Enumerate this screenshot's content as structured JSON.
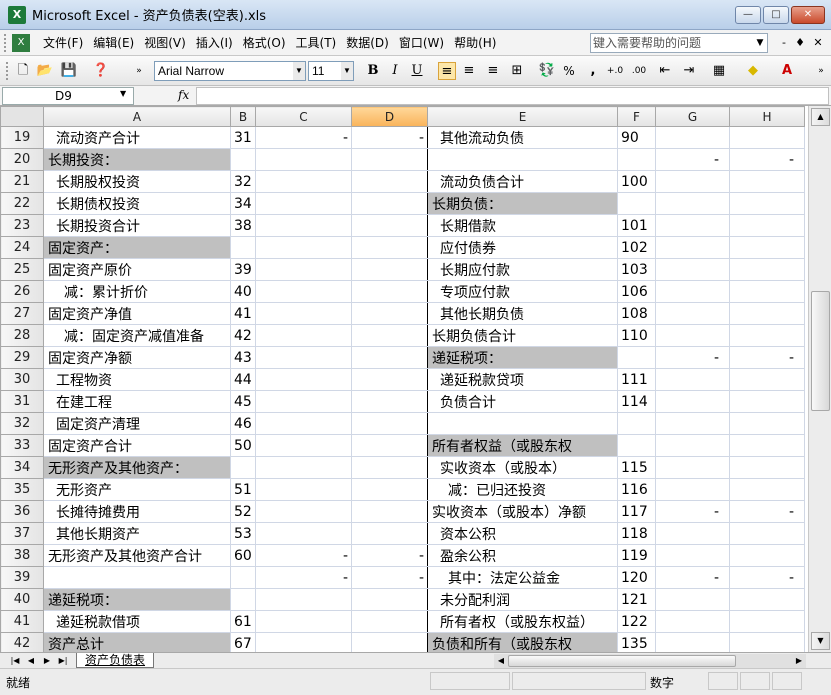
{
  "window": {
    "title": "Microsoft Excel - 资产负债表(空表).xls",
    "app_icon": "excel-icon",
    "buttons": {
      "minimize": "—",
      "maximize": "□",
      "close": "✕"
    }
  },
  "menu": {
    "items": [
      "文件(F)",
      "编辑(E)",
      "视图(V)",
      "插入(I)",
      "格式(O)",
      "工具(T)",
      "数据(D)",
      "窗口(W)",
      "帮助(H)"
    ],
    "help_placeholder": "键入需要帮助的问题",
    "doc_buttons": [
      "-",
      "♦",
      "✕"
    ]
  },
  "toolbar": {
    "font": "Arial Narrow",
    "size": "11",
    "bold": "B",
    "italic": "I",
    "underline": "U",
    "percent": "%",
    "comma": ","
  },
  "formula_bar": {
    "name_box": "D9",
    "fx": "fx",
    "value": ""
  },
  "columns": [
    "A",
    "B",
    "C",
    "D",
    "E",
    "F",
    "G",
    "H"
  ],
  "selected_column": "D",
  "rows": [
    {
      "n": "19",
      "a": "流动资产合计",
      "a_indent": 1,
      "a_gray": false,
      "b": "31",
      "c": "-",
      "d": "-",
      "e": "其他流动负债",
      "e_indent": 1,
      "e_gray": false,
      "f": "90",
      "g": "",
      "h": ""
    },
    {
      "n": "20",
      "a": "长期投资：",
      "a_indent": 0,
      "a_gray": true,
      "b": "",
      "c": "",
      "d": "",
      "e": "",
      "e_indent": 0,
      "e_gray": false,
      "f": "",
      "g": "-",
      "h": "-"
    },
    {
      "n": "21",
      "a": "长期股权投资",
      "a_indent": 1,
      "a_gray": false,
      "b": "32",
      "c": "",
      "d": "",
      "e": "流动负债合计",
      "e_indent": 1,
      "e_gray": false,
      "f": "100",
      "g": "",
      "h": ""
    },
    {
      "n": "22",
      "a": "长期债权投资",
      "a_indent": 1,
      "a_gray": false,
      "b": "34",
      "c": "",
      "d": "",
      "e": "长期负债：",
      "e_indent": 0,
      "e_gray": true,
      "f": "",
      "g": "",
      "h": ""
    },
    {
      "n": "23",
      "a": "长期投资合计",
      "a_indent": 1,
      "a_gray": false,
      "b": "38",
      "c": "",
      "d": "",
      "e": "长期借款",
      "e_indent": 1,
      "e_gray": false,
      "f": "101",
      "g": "",
      "h": ""
    },
    {
      "n": "24",
      "a": "固定资产：",
      "a_indent": 0,
      "a_gray": true,
      "b": "",
      "c": "",
      "d": "",
      "e": "应付债券",
      "e_indent": 1,
      "e_gray": false,
      "f": "102",
      "g": "",
      "h": ""
    },
    {
      "n": "25",
      "a": "固定资产原价",
      "a_indent": 0,
      "a_gray": false,
      "b": "39",
      "c": "",
      "d": "",
      "e": "长期应付款",
      "e_indent": 1,
      "e_gray": false,
      "f": "103",
      "g": "",
      "h": ""
    },
    {
      "n": "26",
      "a": "减：累计折价",
      "a_indent": 2,
      "a_gray": false,
      "b": "40",
      "c": "",
      "d": "",
      "e": "专项应付款",
      "e_indent": 1,
      "e_gray": false,
      "f": "106",
      "g": "",
      "h": ""
    },
    {
      "n": "27",
      "a": "固定资产净值",
      "a_indent": 0,
      "a_gray": false,
      "b": "41",
      "c": "",
      "d": "",
      "e": "其他长期负债",
      "e_indent": 1,
      "e_gray": false,
      "f": "108",
      "g": "",
      "h": ""
    },
    {
      "n": "28",
      "a": "减：固定资产减值准备",
      "a_indent": 2,
      "a_gray": false,
      "b": "42",
      "c": "",
      "d": "",
      "e": "长期负债合计",
      "e_indent": 0,
      "e_gray": false,
      "f": "110",
      "g": "",
      "h": ""
    },
    {
      "n": "29",
      "a": "固定资产净额",
      "a_indent": 0,
      "a_gray": false,
      "b": "43",
      "c": "",
      "d": "",
      "e": "递延税项：",
      "e_indent": 0,
      "e_gray": true,
      "f": "",
      "g": "-",
      "h": "-"
    },
    {
      "n": "30",
      "a": "工程物资",
      "a_indent": 1,
      "a_gray": false,
      "b": "44",
      "c": "",
      "d": "",
      "e": "递延税款贷项",
      "e_indent": 1,
      "e_gray": false,
      "f": "111",
      "g": "",
      "h": ""
    },
    {
      "n": "31",
      "a": "在建工程",
      "a_indent": 1,
      "a_gray": false,
      "b": "45",
      "c": "",
      "d": "",
      "e": "负债合计",
      "e_indent": 1,
      "e_gray": false,
      "f": "114",
      "g": "",
      "h": ""
    },
    {
      "n": "32",
      "a": "固定资产清理",
      "a_indent": 1,
      "a_gray": false,
      "b": "46",
      "c": "",
      "d": "",
      "e": "",
      "e_indent": 0,
      "e_gray": false,
      "f": "",
      "g": "",
      "h": ""
    },
    {
      "n": "33",
      "a": "固定资产合计",
      "a_indent": 0,
      "a_gray": false,
      "b": "50",
      "c": "",
      "d": "",
      "e": "所有者权益（或股东权",
      "e_indent": 0,
      "e_gray": true,
      "f": "",
      "g": "",
      "h": ""
    },
    {
      "n": "34",
      "a": "无形资产及其他资产：",
      "a_indent": 0,
      "a_gray": true,
      "b": "",
      "c": "",
      "d": "",
      "e": "实收资本（或股本）",
      "e_indent": 1,
      "e_gray": false,
      "f": "115",
      "g": "",
      "h": ""
    },
    {
      "n": "35",
      "a": "无形资产",
      "a_indent": 1,
      "a_gray": false,
      "b": "51",
      "c": "",
      "d": "",
      "e": "减：已归还投资",
      "e_indent": 2,
      "e_gray": false,
      "f": "116",
      "g": "",
      "h": ""
    },
    {
      "n": "36",
      "a": "长摊待摊费用",
      "a_indent": 1,
      "a_gray": false,
      "b": "52",
      "c": "",
      "d": "",
      "e": "实收资本（或股本）净额",
      "e_indent": 0,
      "e_gray": false,
      "f": "117",
      "g": "-",
      "h": "-"
    },
    {
      "n": "37",
      "a": "其他长期资产",
      "a_indent": 1,
      "a_gray": false,
      "b": "53",
      "c": "",
      "d": "",
      "e": "资本公积",
      "e_indent": 1,
      "e_gray": false,
      "f": "118",
      "g": "",
      "h": ""
    },
    {
      "n": "38",
      "a": "无形资产及其他资产合计",
      "a_indent": 0,
      "a_gray": false,
      "b": "60",
      "c": "-",
      "d": "-",
      "e": "盈余公积",
      "e_indent": 1,
      "e_gray": false,
      "f": "119",
      "g": "",
      "h": ""
    },
    {
      "n": "39",
      "a": "",
      "a_indent": 0,
      "a_gray": false,
      "b": "",
      "c": "-",
      "d": "-",
      "e": "其中：法定公益金",
      "e_indent": 2,
      "e_gray": false,
      "f": "120",
      "g": "-",
      "h": "-"
    },
    {
      "n": "40",
      "a": "递延税项：",
      "a_indent": 0,
      "a_gray": true,
      "b": "",
      "c": "",
      "d": "",
      "e": "未分配利润",
      "e_indent": 1,
      "e_gray": false,
      "f": "121",
      "g": "",
      "h": ""
    },
    {
      "n": "41",
      "a": "递延税款借项",
      "a_indent": 1,
      "a_gray": false,
      "b": "61",
      "c": "",
      "d": "",
      "e": "所有者权（或股东权益）",
      "e_indent": 1,
      "e_gray": false,
      "f": "122",
      "g": "",
      "h": ""
    },
    {
      "n": "42",
      "a": "资产总计",
      "a_indent": 0,
      "a_gray": true,
      "b": "67",
      "c": "",
      "d": "",
      "e": "负债和所有（或股东权",
      "e_indent": 0,
      "e_gray": true,
      "f": "135",
      "g": "",
      "h": ""
    }
  ],
  "sheet_tabs": [
    "资产负债表"
  ],
  "status": {
    "ready": "就绪",
    "mode": "数字"
  },
  "colors": {
    "title_bar": "#c6d8ee",
    "header_gray": "#c0c0c0",
    "selected_header": "#f9b35a",
    "grid_line": "#d0d7e5"
  }
}
